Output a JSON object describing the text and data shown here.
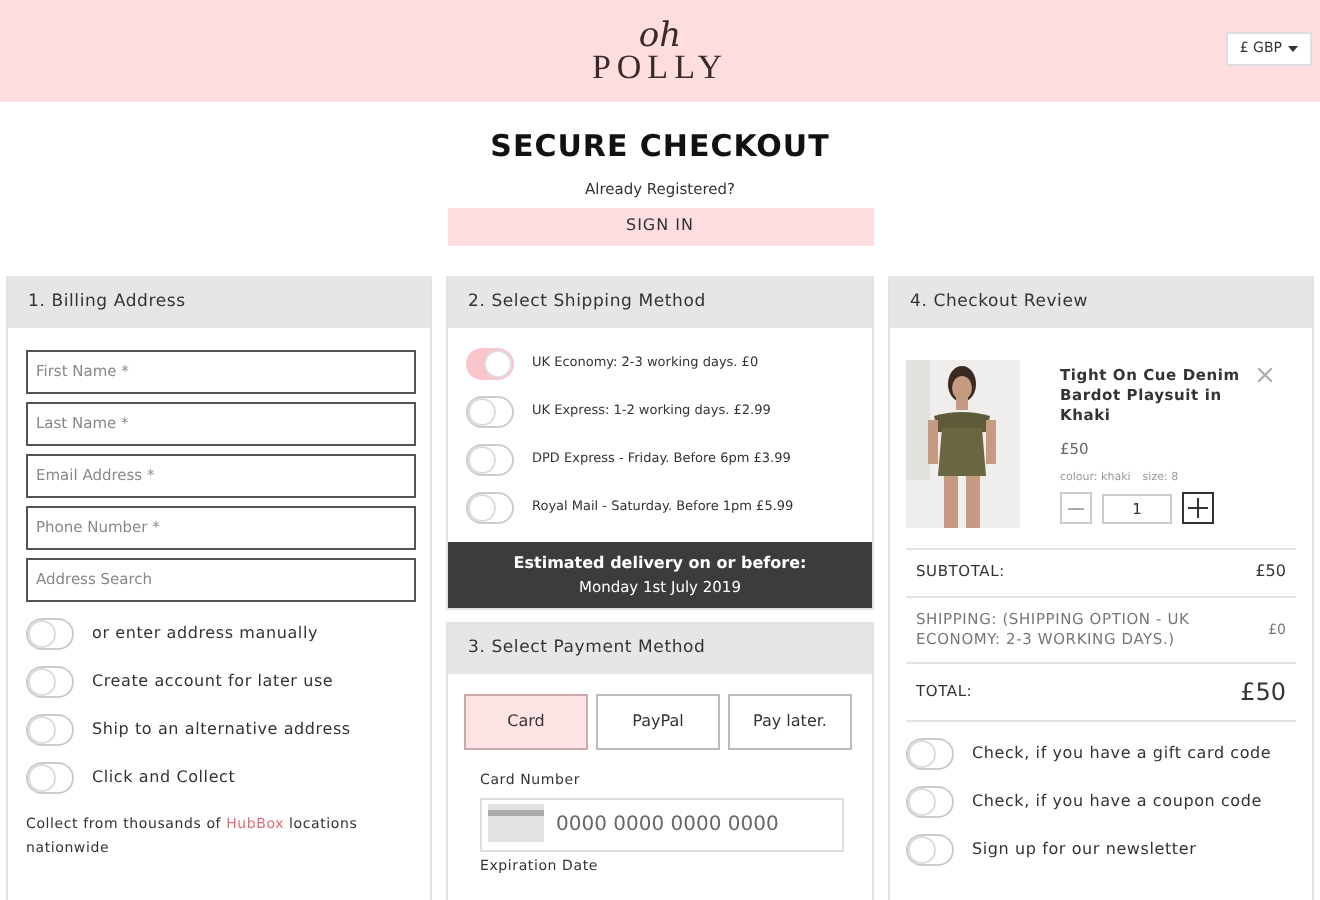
{
  "header": {
    "logo": {
      "script": "oh",
      "word": "POLLY"
    },
    "currency": "£ GBP",
    "title": "SECURE CHECKOUT",
    "subtitle": "Already Registered?",
    "sign_in": "SIGN IN"
  },
  "billing": {
    "title": "1. Billing Address",
    "fields": [
      {
        "placeholder": "First Name *"
      },
      {
        "placeholder": "Last Name *"
      },
      {
        "placeholder": "Email Address *"
      },
      {
        "placeholder": "Phone Number *"
      },
      {
        "placeholder": "Address Search"
      }
    ],
    "options": [
      {
        "label": "or enter address manually",
        "on": false
      },
      {
        "label": "Create account for later use",
        "on": false
      },
      {
        "label": "Ship to an alternative address",
        "on": false
      },
      {
        "label": "Click and Collect",
        "on": false
      }
    ],
    "note": {
      "before": "Collect from thousands of",
      "link": "HubBox",
      "after": "locations nationwide"
    }
  },
  "shipping": {
    "title": "2. Select Shipping Method",
    "options": [
      {
        "label": "UK Economy: 2-3 working days. £0",
        "selected": true
      },
      {
        "label": "UK Express: 1-2 working days. £2.99",
        "selected": false
      },
      {
        "label": "DPD Express - Friday. Before 6pm £3.99",
        "selected": false
      },
      {
        "label": "Royal Mail - Saturday. Before 1pm £5.99",
        "selected": false
      }
    ],
    "delivery": {
      "line1": "Estimated delivery on or before:",
      "line2": "Monday 1st July 2019"
    }
  },
  "payment": {
    "title": "3. Select Payment Method",
    "methods": [
      {
        "label": "Card",
        "selected": true
      },
      {
        "label": "PayPal",
        "selected": false
      },
      {
        "label": "Pay later.",
        "selected": false
      }
    ],
    "card_number": {
      "label": "Card Number",
      "placeholder": "0000 0000 0000 0000"
    },
    "expiration_label": "Expiration Date"
  },
  "review": {
    "title": "4. Checkout Review",
    "item": {
      "name": "Tight On Cue Denim Bardot Playsuit in Khaki",
      "price": "£50",
      "colour": "colour: khaki",
      "size": "size: 8",
      "quantity": "1"
    },
    "subtotal": {
      "label": "SUBTOTAL:",
      "value": "£50"
    },
    "shipping": {
      "label": "SHIPPING: (SHIPPING OPTION - UK ECONOMY: 2-3 WORKING DAYS.)",
      "value": "£0"
    },
    "total": {
      "label": "TOTAL:",
      "value": "£50"
    },
    "options": [
      {
        "label": "Check, if you have a gift card code",
        "on": false
      },
      {
        "label": "Check, if you have a coupon code",
        "on": false
      },
      {
        "label": "Sign up for our newsletter",
        "on": false
      }
    ]
  }
}
